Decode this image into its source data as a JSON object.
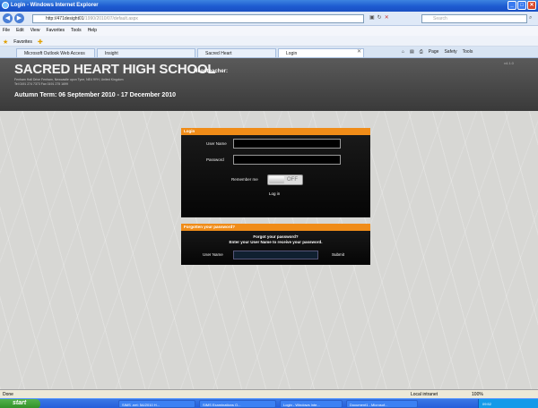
{
  "window": {
    "title": "Login - Windows Internet Explorer"
  },
  "address": {
    "url": "http://471desight01",
    "url_rest": "/1990/2010/07/default.aspx"
  },
  "search": {
    "placeholder": "Search"
  },
  "menu": [
    "File",
    "Edit",
    "View",
    "Favorites",
    "Tools",
    "Help"
  ],
  "favorites": {
    "label": "Favorites"
  },
  "tabs": [
    "Microsoft Outlook Web Access",
    "Insight",
    "Sacred Heart",
    "Login"
  ],
  "toolbar": [
    "Page",
    "Safety",
    "Tools"
  ],
  "header": {
    "school": "SACRED HEART HIGH SCHOOL",
    "role": "Headteacher:",
    "address_line1": "Fenham Hall Drive Fenham, Newcastle upon Tyne, NE4 9YH, United Kingdom",
    "address_line2": "Tel 0191 274 7373 Fax 0191 275 1699",
    "term": "Autumn Term: 06 September 2010 - 17 December 2010",
    "version": "v4.1.0"
  },
  "login": {
    "heading": "Login",
    "username_label": "User Name",
    "password_label": "Password",
    "remember_label": "Remember me",
    "toggle_state": "OFF",
    "button": "Log in"
  },
  "forgot": {
    "heading": "Forgotten your password?",
    "line1": "Forgot your password?",
    "line2": "Enter your User Name to receive your password.",
    "username_label": "User Name",
    "submit": "Submit"
  },
  "status": {
    "left": "Done",
    "zone": "Local intranet",
    "zoom": "100%"
  },
  "taskbar": {
    "start": "start",
    "tasks": [
      "SIMS .net: 5A/2010 H...",
      "SIMS Examinations O...",
      "Login - Windows Inte...",
      "Document1 - Microsof..."
    ],
    "clock": "09:52"
  }
}
